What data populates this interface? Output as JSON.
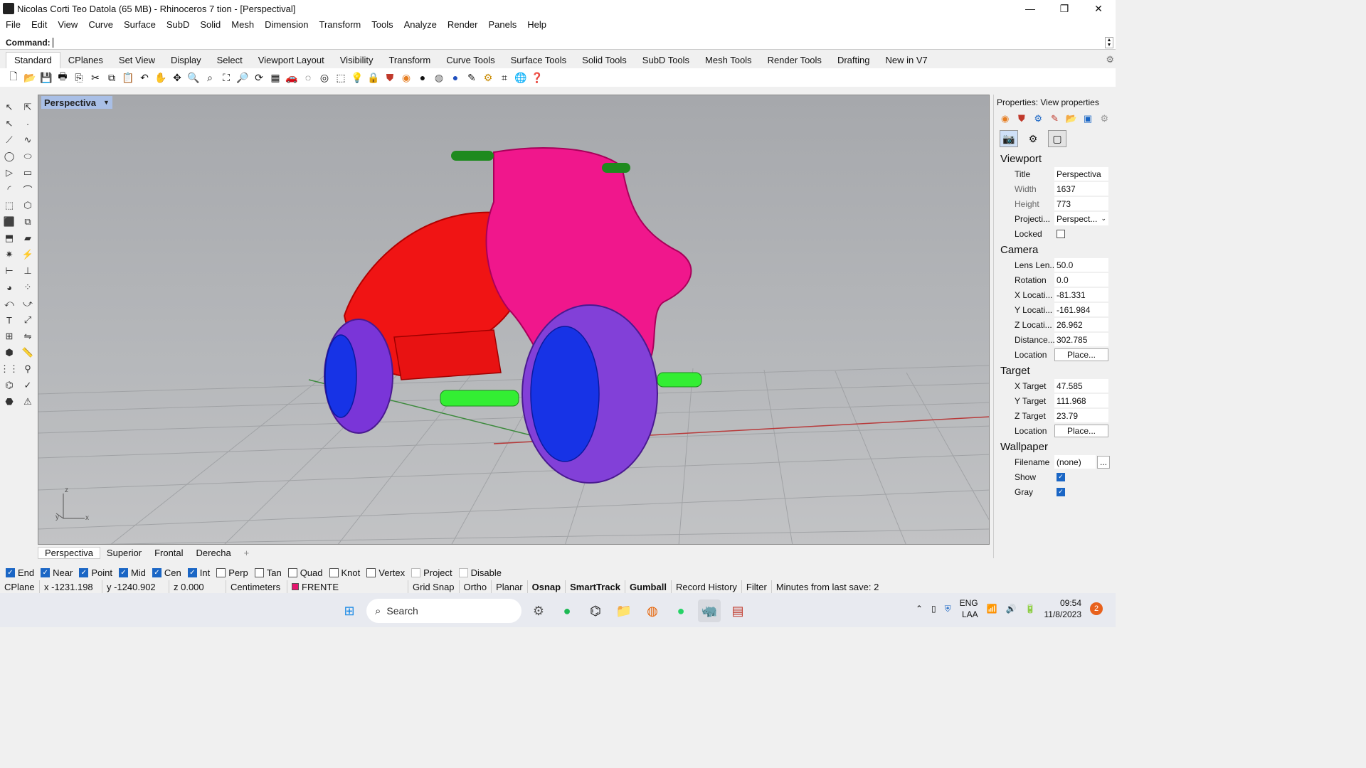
{
  "window": {
    "title": "Nicolas Corti Teo Datola (65 MB) - Rhinoceros 7 tion - [Perspectival]",
    "minimize": "—",
    "restore": "❐",
    "close": "✕"
  },
  "menu": [
    "File",
    "Edit",
    "View",
    "Curve",
    "Surface",
    "SubD",
    "Solid",
    "Mesh",
    "Dimension",
    "Transform",
    "Tools",
    "Analyze",
    "Render",
    "Panels",
    "Help"
  ],
  "command": {
    "label": "Command:",
    "value": ""
  },
  "toolbar_tabs": [
    "Standard",
    "CPlanes",
    "Set View",
    "Display",
    "Select",
    "Viewport Layout",
    "Visibility",
    "Transform",
    "Curve Tools",
    "Surface Tools",
    "Solid Tools",
    "SubD Tools",
    "Mesh Tools",
    "Render Tools",
    "Drafting",
    "New in V7"
  ],
  "toolbar_icons": [
    "new-icon",
    "open-icon",
    "save-icon",
    "print-icon",
    "import-icon",
    "cut-icon",
    "copy-icon",
    "paste-icon",
    "undo-icon",
    "pan-icon",
    "move-icon",
    "zoom-in-icon",
    "zoom-window-icon",
    "zoom-extents-icon",
    "zoom-selected-icon",
    "rotate-view-icon",
    "grid-icon",
    "car-icon",
    "hide-icon",
    "show-icon",
    "select-icon",
    "light-icon",
    "lock-icon",
    "material-icon",
    "color-wheel-icon",
    "sphere-icon",
    "render-sphere-icon",
    "blue-sphere-icon",
    "pen-icon",
    "settings-icon",
    "options-icon",
    "globe-icon",
    "help-icon"
  ],
  "viewport": {
    "label": "Perspectiva"
  },
  "viewport_tabs": [
    "Perspectiva",
    "Superior",
    "Frontal",
    "Derecha"
  ],
  "viewport_add": "+",
  "osnaps": [
    {
      "label": "End",
      "on": true
    },
    {
      "label": "Near",
      "on": true
    },
    {
      "label": "Point",
      "on": true
    },
    {
      "label": "Mid",
      "on": true
    },
    {
      "label": "Cen",
      "on": true
    },
    {
      "label": "Int",
      "on": true
    },
    {
      "label": "Perp",
      "on": false
    },
    {
      "label": "Tan",
      "on": false
    },
    {
      "label": "Quad",
      "on": false
    },
    {
      "label": "Knot",
      "on": false
    },
    {
      "label": "Vertex",
      "on": false
    },
    {
      "label": "Project",
      "on": false
    },
    {
      "label": "Disable",
      "on": false
    }
  ],
  "status": {
    "cplane": "CPlane",
    "x": "x -1231.198",
    "y": "y -1240.902",
    "z": "z 0.000",
    "units": "Centimeters",
    "layer": "FRENTE",
    "layer_color": "#e6156e",
    "grid_snap": "Grid Snap",
    "ortho": "Ortho",
    "planar": "Planar",
    "osnap": "Osnap",
    "smarttrack": "SmartTrack",
    "gumball": "Gumball",
    "record_history": "Record History",
    "filter": "Filter",
    "last_save": "Minutes from last save: 2"
  },
  "properties": {
    "title": "Properties: View properties",
    "viewport_section": "Viewport",
    "viewport_rows": [
      {
        "k": "Title",
        "v": "Perspectiva"
      },
      {
        "k": "Width",
        "v": "1637"
      },
      {
        "k": "Height",
        "v": "773"
      },
      {
        "k": "Projecti...",
        "v": "Perspect..."
      }
    ],
    "locked_label": "Locked",
    "camera_section": "Camera",
    "camera_rows": [
      {
        "k": "Lens Len...",
        "v": "50.0"
      },
      {
        "k": "Rotation",
        "v": "0.0"
      },
      {
        "k": "X Locati...",
        "v": "-81.331"
      },
      {
        "k": "Y Locati...",
        "v": "-161.984"
      },
      {
        "k": "Z Locati...",
        "v": "26.962"
      },
      {
        "k": "Distance...",
        "v": "302.785"
      }
    ],
    "location_label": "Location",
    "place_button": "Place...",
    "target_section": "Target",
    "target_rows": [
      {
        "k": "X Target",
        "v": "47.585"
      },
      {
        "k": "Y Target",
        "v": "111.968"
      },
      {
        "k": "Z Target",
        "v": "23.79"
      }
    ],
    "wallpaper_section": "Wallpaper",
    "filename_label": "Filename",
    "filename_value": "(none)",
    "browse": "...",
    "show_label": "Show",
    "gray_label": "Gray"
  },
  "taskbar": {
    "search_placeholder": "Search",
    "lang": "ENG",
    "lang2": "LAA",
    "time": "09:54",
    "date": "11/8/2023",
    "notifications": "2"
  }
}
